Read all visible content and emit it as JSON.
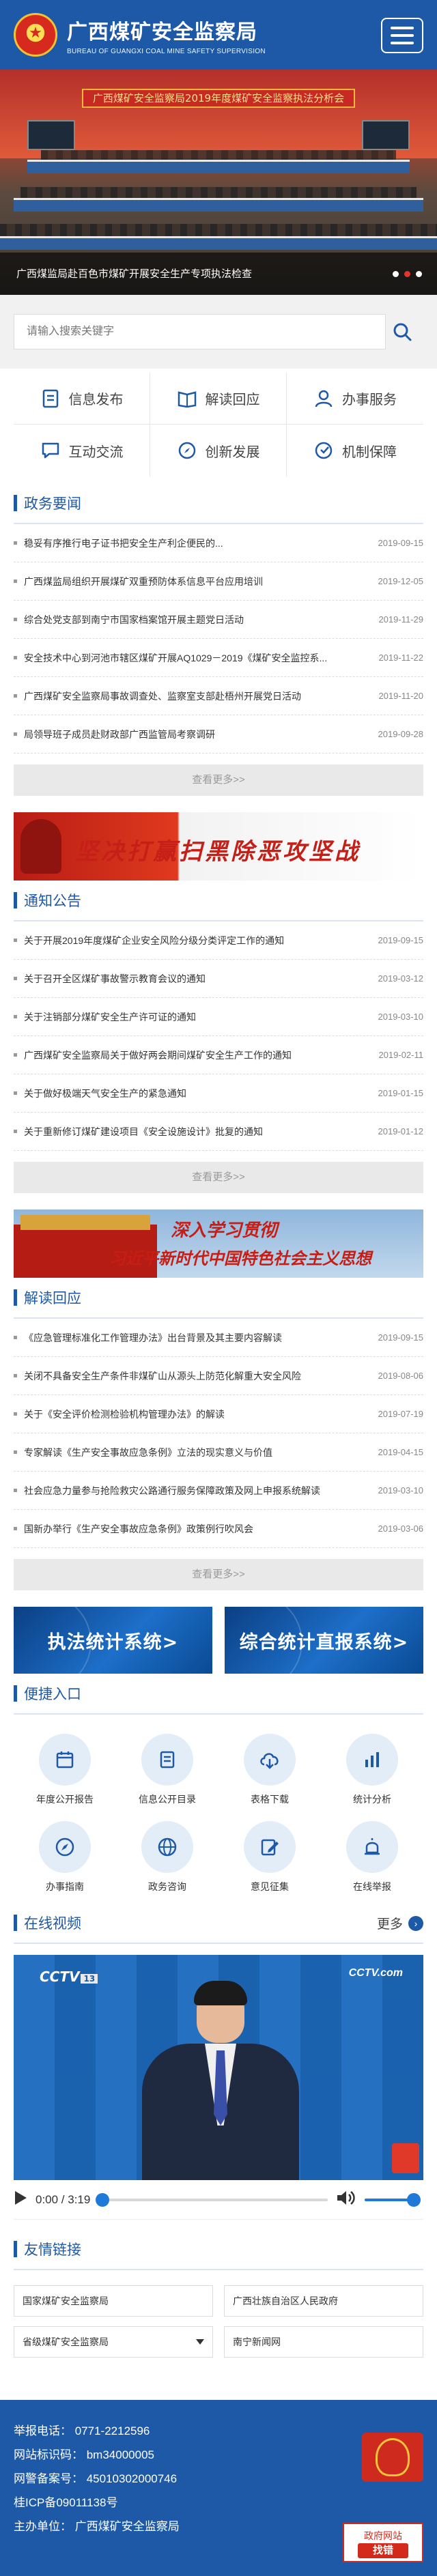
{
  "header": {
    "title_cn": "广西煤矿安全监察局",
    "title_en": "BUREAU OF GUANGXI COAL MINE SAFETY SUPERVISION"
  },
  "banner": {
    "stage_text": "广西煤矿安全监察局2019年度煤矿安全监察执法分析会",
    "caption": "广西煤监局赴百色市煤矿开展安全生产专项执法检查"
  },
  "search": {
    "placeholder": "请输入搜索关键字"
  },
  "quicknav": [
    {
      "label": "信息发布",
      "icon": "document-icon"
    },
    {
      "label": "解读回应",
      "icon": "book-icon"
    },
    {
      "label": "办事服务",
      "icon": "user-service-icon"
    },
    {
      "label": "互动交流",
      "icon": "chat-icon"
    },
    {
      "label": "创新发展",
      "icon": "compass-icon"
    },
    {
      "label": "机制保障",
      "icon": "shield-icon"
    }
  ],
  "sections": {
    "gov_news": {
      "title": "政务要闻",
      "items": [
        {
          "title": "稳妥有序推行电子证书把安全生产利企便民的...",
          "date": "2019-09-15"
        },
        {
          "title": "广西煤监局组织开展煤矿双重预防体系信息平台应用培训",
          "date": "2019-12-05"
        },
        {
          "title": "综合处党支部到南宁市国家档案馆开展主题党日活动",
          "date": "2019-11-29"
        },
        {
          "title": "安全技术中心到河池市辖区煤矿开展AQ1029－2019《煤矿安全监控系...",
          "date": "2019-11-22"
        },
        {
          "title": "广西煤矿安全监察局事故调查处、监察室支部赴梧州开展党日活动",
          "date": "2019-11-20"
        },
        {
          "title": "局领导班子成员赴财政部广西监管局考察调研",
          "date": "2019-09-28"
        }
      ],
      "more": "查看更多>>"
    },
    "notices": {
      "title": "通知公告",
      "items": [
        {
          "title": "关于开展2019年度煤矿企业安全风险分级分类评定工作的通知",
          "date": "2019-09-15"
        },
        {
          "title": "关于召开全区煤矿事故警示教育会议的通知",
          "date": "2019-03-12"
        },
        {
          "title": "关于注销部分煤矿安全生产许可证的通知",
          "date": "2019-03-10"
        },
        {
          "title": "广西煤矿安全监察局关于做好两会期间煤矿安全生产工作的通知",
          "date": "2019-02-11"
        },
        {
          "title": "关于做好极端天气安全生产的紧急通知",
          "date": "2019-01-15"
        },
        {
          "title": "关于重新修订煤矿建设项目《安全设施设计》批复的通知",
          "date": "2019-01-12"
        }
      ],
      "more": "查看更多>>"
    },
    "interpret": {
      "title": "解读回应",
      "items": [
        {
          "title": "《应急管理标准化工作管理办法》出台背景及其主要内容解读",
          "date": "2019-09-15"
        },
        {
          "title": "关闭不具备安全生产条件非煤矿山从源头上防范化解重大安全风险",
          "date": "2019-08-06"
        },
        {
          "title": "关于《安全评价检测检验机构管理办法》的解读",
          "date": "2019-07-19"
        },
        {
          "title": "专家解读《生产安全事故应急条例》立法的现实意义与价值",
          "date": "2019-04-15"
        },
        {
          "title": "社会应急力量参与抢险救灾公路通行服务保障政策及网上申报系统解读",
          "date": "2019-03-10"
        },
        {
          "title": "国新办举行《生产安全事故应急条例》政策例行吹风会",
          "date": "2019-03-06"
        }
      ],
      "more": "查看更多>>"
    }
  },
  "ads": {
    "ad1_text": "坚决打赢扫黑除恶攻坚战",
    "ad2_line1": "深入学习贯彻",
    "ad2_line2": "习近平新时代中国特色社会主义思想"
  },
  "stats": {
    "card1": "执法统计系统>",
    "card2": "综合统计直报系统>"
  },
  "entry": {
    "title": "便捷入口",
    "items": [
      {
        "label": "年度公开报告",
        "icon": "calendar-icon"
      },
      {
        "label": "信息公开目录",
        "icon": "list-icon"
      },
      {
        "label": "表格下载",
        "icon": "cloud-download-icon"
      },
      {
        "label": "统计分析",
        "icon": "bar-chart-icon"
      },
      {
        "label": "办事指南",
        "icon": "compass-icon"
      },
      {
        "label": "政务咨询",
        "icon": "globe-icon"
      },
      {
        "label": "意见征集",
        "icon": "edit-icon"
      },
      {
        "label": "在线举报",
        "icon": "alarm-icon"
      }
    ]
  },
  "video": {
    "title": "在线视频",
    "more": "更多",
    "channel": "CCTV",
    "channel_num": "13",
    "channel_right": "CCTV.com",
    "time": "0:00 / 3:19",
    "progress": 0,
    "volume": 1
  },
  "friend": {
    "title": "友情链接",
    "items": [
      {
        "label": "国家煤矿安全监察局",
        "dropdown": false
      },
      {
        "label": "广西壮族自治区人民政府",
        "dropdown": false
      },
      {
        "label": "省级煤矿安全监察局",
        "dropdown": true
      },
      {
        "label": "南宁新闻网",
        "dropdown": false
      }
    ]
  },
  "footer": {
    "phone": "举报电话：  0771-2212596",
    "site_id": "网站标识码：  bm34000005",
    "police": "网警备案号：  45010302000746",
    "icp": "桂ICP备09011138号",
    "host": "主办单位：  广西煤矿安全监察局",
    "find_err_title": "政府网站",
    "find_err_btn": "找错"
  },
  "colors": {
    "primary": "#1e59a8",
    "accent_red": "#d42a1c"
  }
}
